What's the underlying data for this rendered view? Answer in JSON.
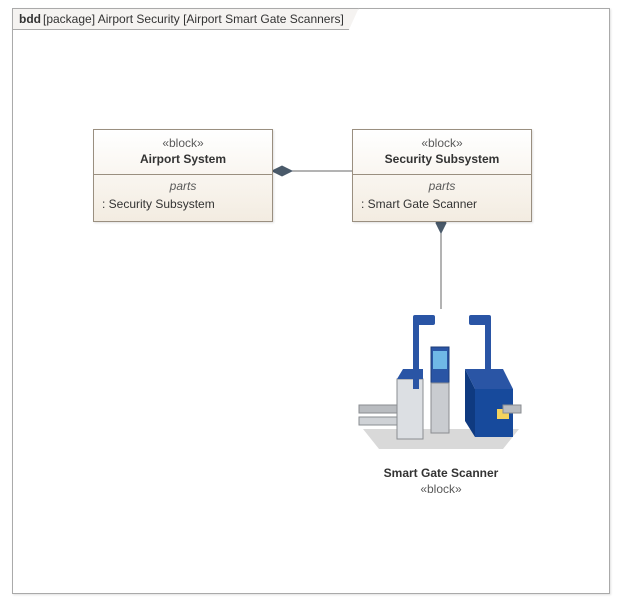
{
  "frame": {
    "prefix": "bdd",
    "label": "[package] Airport Security [Airport Smart Gate Scanners]"
  },
  "block1": {
    "stereotype": "«block»",
    "name": "Airport System",
    "parts_label": "parts",
    "parts_value": ": Security Subsystem"
  },
  "block2": {
    "stereotype": "«block»",
    "name": "Security Subsystem",
    "parts_label": "parts",
    "parts_value": ": Smart Gate Scanner"
  },
  "block3": {
    "name": "Smart Gate Scanner",
    "stereotype": "«block»"
  }
}
